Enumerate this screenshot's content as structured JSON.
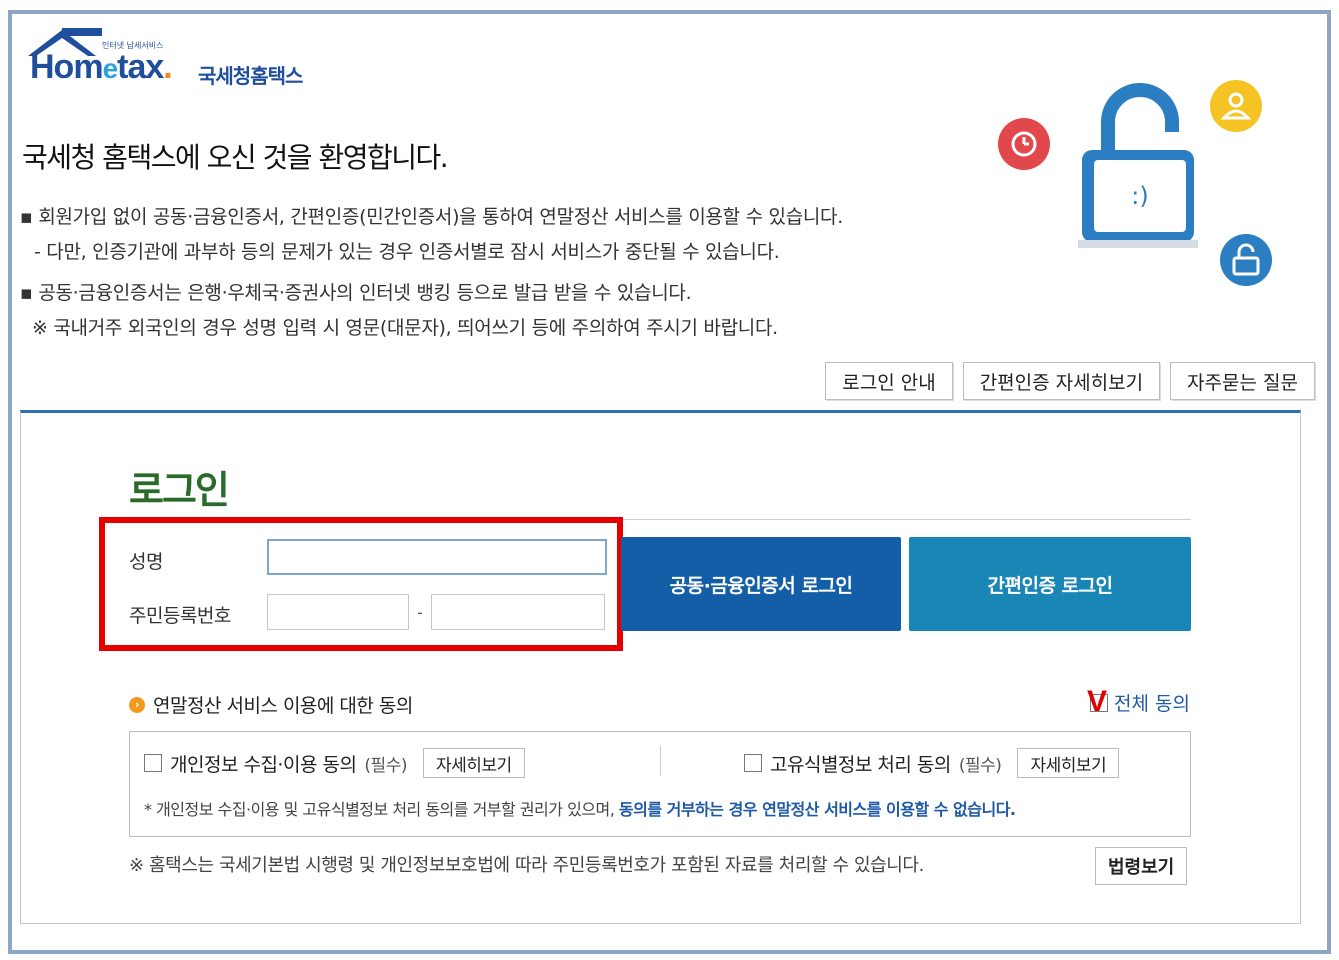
{
  "logo": {
    "tiny_text": "인터넷 납세서비스",
    "word_home": "Hom",
    "word_e": "e",
    "word_tax": "tax",
    "word_dot": ".",
    "korean_name": "국세청홈택스"
  },
  "welcome": "국세청 홈택스에 오신 것을 환영합니다.",
  "info_lines": {
    "l1": "▪ 회원가입 없이 공동·금융인증서, 간편인증(민간인증서)을 통하여 연말정산 서비스를 이용할 수 있습니다.",
    "l2": "- 다만, 인증기관에 과부하 등의 문제가 있는 경우 인증서별로 잠시 서비스가 중단될 수 있습니다.",
    "l3": "▪ 공동·금융인증서는 은행·우체국·증권사의 인터넷 뱅킹 등으로 발급 받을 수 있습니다.",
    "l4": "※ 국내거주 외국인의 경우 성명 입력 시 영문(대문자), 띄어쓰기 등에 주의하여 주시기 바랍니다."
  },
  "illustration": {
    "icons": [
      "clock-icon",
      "padlock-icon",
      "user-icon",
      "lock-icon"
    ],
    "colors": {
      "red": "#e0484c",
      "blue": "#2b7ec1",
      "yellow": "#f6c325"
    }
  },
  "help_buttons": {
    "login_guide": "로그인 안내",
    "easy_auth_detail": "간편인증 자세히보기",
    "faq": "자주묻는 질문"
  },
  "login": {
    "title": "로그인",
    "name_label": "성명",
    "name_value": "",
    "rrn_label": "주민등록번호",
    "rrn_front_value": "",
    "rrn_dash": "-",
    "rrn_back_value": "",
    "cert_login": "공동·금융인증서 로그인",
    "easy_login": "간편인증 로그인"
  },
  "agreement": {
    "heading": "연말정산 서비스 이용에 대한 동의",
    "agree_all": "전체 동의",
    "agree_all_checked": false,
    "item1_label": "개인정보 수집·이용 동의",
    "item1_req": "(필수)",
    "item2_label": "고유식별정보 처리 동의",
    "item2_req": "(필수)",
    "detail": "자세히보기",
    "note_plain": "* 개인정보 수집·이용 및 고유식별정보 처리 동의를 거부할 권리가 있으며, ",
    "note_bold": "동의를 거부하는 경우 연말정산 서비스를 이용할 수 없습니다."
  },
  "law": {
    "text": "※ 홈택스는 국세기본법 시행령 및 개인정보보호법에 따라 주민등록번호가 포함된 자료를 처리할 수 있습니다.",
    "button": "법령보기"
  },
  "annotation": {
    "mark": "V",
    "box_color": "#e60000"
  }
}
